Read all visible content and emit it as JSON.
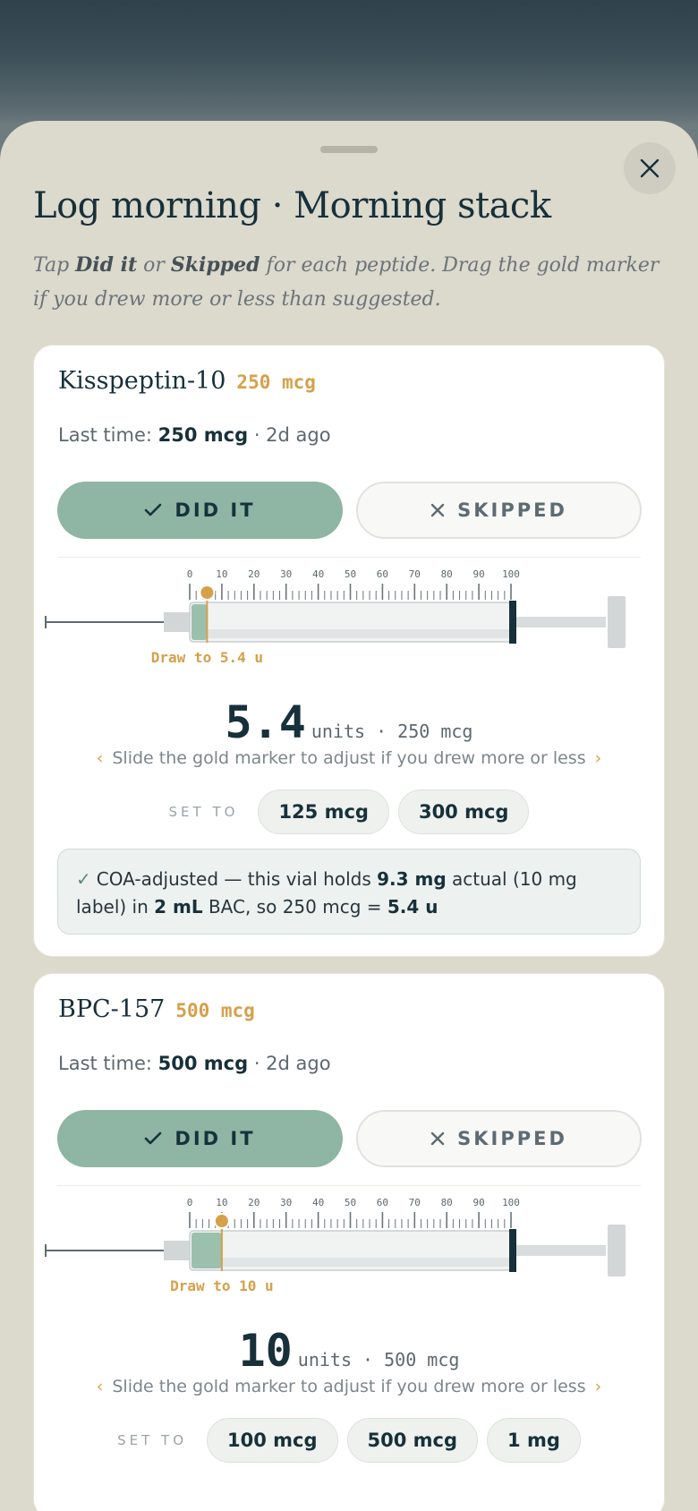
{
  "sheet": {
    "title": "Log morning · Morning stack",
    "subtitle_parts": [
      "Tap ",
      "Did it",
      " or ",
      "Skipped",
      " for each peptide. Drag the gold marker if you drew more or less than suggested."
    ]
  },
  "close_icon": "close-icon",
  "colors": {
    "accent_gold": "#d6a04a",
    "did_it_green": "#8fb5a4",
    "ink": "#173039",
    "sheet_bg": "#dcd9cd"
  },
  "scale_labels": [
    "0",
    "10",
    "20",
    "30",
    "40",
    "50",
    "60",
    "70",
    "80",
    "90",
    "100"
  ],
  "peptides": [
    {
      "name": "Kisspeptin-10",
      "dose": "250 mcg",
      "last_time_prefix": "Last time: ",
      "last_time_value": "250 mcg",
      "last_time_suffix": " · 2d ago",
      "did_it_label": "DID IT",
      "skipped_label": "SKIPPED",
      "draw_units": 5.4,
      "draw_label": "Draw to 5.4 u",
      "units_value": "5.4",
      "units_suffix": "units · 250 mcg",
      "hint": "Slide the gold marker to adjust if you drew more or less",
      "set_to_label": "SET TO",
      "presets": [
        "125 mcg",
        "300 mcg"
      ],
      "coa": {
        "p1": "COA-adjusted — this vial holds ",
        "b1": "9.3 mg",
        "p2": " actual (10 mg label) in ",
        "b2": "2 mL",
        "p3": " BAC, so 250 mcg = ",
        "b3": "5.4 u"
      }
    },
    {
      "name": "BPC-157",
      "dose": "500 mcg",
      "last_time_prefix": "Last time: ",
      "last_time_value": "500 mcg",
      "last_time_suffix": " · 2d ago",
      "did_it_label": "DID IT",
      "skipped_label": "SKIPPED",
      "draw_units": 10,
      "draw_label": "Draw to 10 u",
      "units_value": "10",
      "units_suffix": "units · 500 mcg",
      "hint": "Slide the gold marker to adjust if you drew more or less",
      "set_to_label": "SET TO",
      "presets": [
        "100 mcg",
        "500 mcg",
        "1 mg"
      ]
    }
  ]
}
